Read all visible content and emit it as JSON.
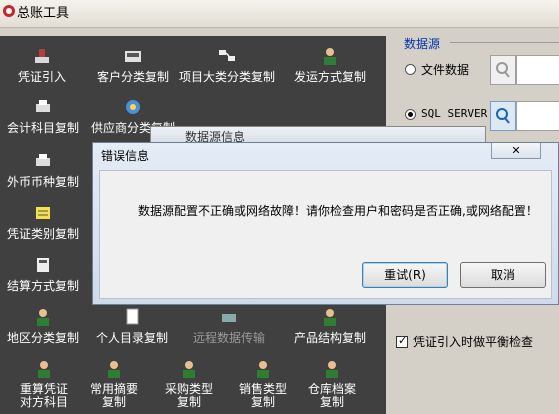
{
  "window": {
    "title": "总账工具"
  },
  "tools": [
    {
      "label": "凭证引入",
      "icon": "stamp-icon"
    },
    {
      "label": "客户分类复制",
      "icon": "register-icon"
    },
    {
      "label": "项目大类分类复制",
      "icon": "transfer-icon"
    },
    {
      "label": "发运方式复制",
      "icon": "person-icon"
    },
    {
      "label": "会计科目复制",
      "icon": "printer-icon"
    },
    {
      "label": "供应商分类复制",
      "icon": "network-icon"
    },
    {
      "label": "外币币种复制",
      "icon": "printer-icon"
    },
    {
      "label": "凭证类别复制",
      "icon": "folder-icon"
    },
    {
      "label": "结算方式复制",
      "icon": "calculator-icon"
    },
    {
      "label": "地区分类复制",
      "icon": "person-icon"
    },
    {
      "label": "个人目录复制",
      "icon": "document-icon"
    },
    {
      "label": "远程数据传输",
      "icon": "remote-icon"
    },
    {
      "label": "产品结构复制",
      "icon": "person-icon"
    },
    {
      "label": "重算凭证对方科目",
      "icon": "person-icon"
    },
    {
      "label": "常用摘要复制",
      "icon": "person-icon"
    },
    {
      "label": "采购类型复制",
      "icon": "person-icon"
    },
    {
      "label": "销售类型复制",
      "icon": "person-icon"
    },
    {
      "label": "仓库档案复制",
      "icon": "person-icon"
    }
  ],
  "datasource": {
    "title": "数据源",
    "options": [
      {
        "label": "文件数据",
        "selected": false
      },
      {
        "label": "SQL SERVER",
        "selected": true
      }
    ]
  },
  "balance_check": {
    "label": "凭证引入时做平衡检查",
    "checked": true
  },
  "background_dialog": {
    "title": "数据源信息"
  },
  "error_dialog": {
    "title": "错误信息",
    "message": "数据源配置不正确或网络故障！请你检查用户和密码是否正确,或网络配置！",
    "retry_label": "重试(R)",
    "cancel_label": "取消"
  }
}
